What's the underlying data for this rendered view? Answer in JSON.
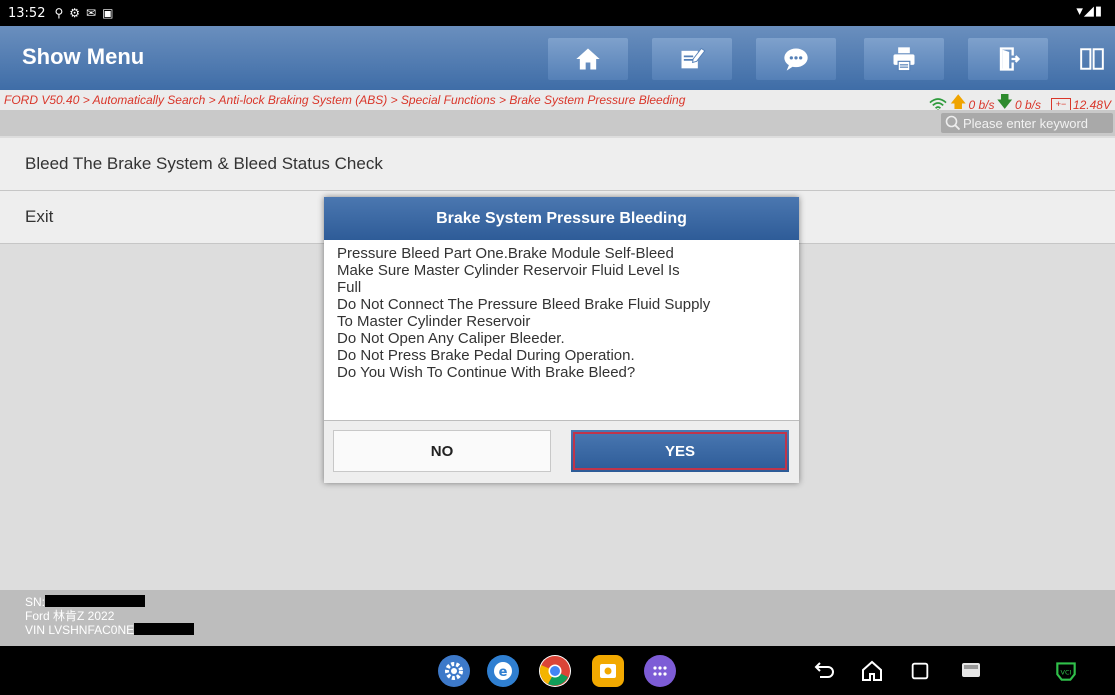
{
  "status_bar": {
    "time": "13:52"
  },
  "header": {
    "title": "Show Menu"
  },
  "breadcrumb": "FORD V50.40 > Automatically Search > Anti-lock Braking System (ABS) > Special Functions > Brake System Pressure Bleeding",
  "network": {
    "upload": "0 b/s",
    "download": "0 b/s",
    "voltage": "12.48V"
  },
  "search": {
    "placeholder": "Please enter keyword"
  },
  "menu": {
    "items": [
      {
        "label": "Bleed The Brake System & Bleed Status Check"
      },
      {
        "label": "Exit"
      }
    ]
  },
  "dialog": {
    "title": "Brake System Pressure Bleeding",
    "lines": [
      "Pressure Bleed Part One.Brake Module Self-Bleed",
      "Make Sure Master Cylinder Reservoir Fluid Level Is",
      "Full",
      "Do Not Connect The Pressure Bleed Brake Fluid Supply",
      "To Master Cylinder Reservoir",
      "Do Not Open Any Caliper Bleeder.",
      "Do Not Press Brake Pedal During Operation.",
      "Do You Wish To Continue With Brake Bleed?"
    ],
    "no_label": "NO",
    "yes_label": "YES"
  },
  "footer": {
    "sn_label": "SN:",
    "vehicle": "Ford 林肯Z 2022",
    "vin_label": "VIN LVSHNFAC0NE"
  },
  "colors": {
    "header_blue": "#3f6da7",
    "crumb_red": "#d9362a",
    "highlight_red": "#c0344a"
  }
}
